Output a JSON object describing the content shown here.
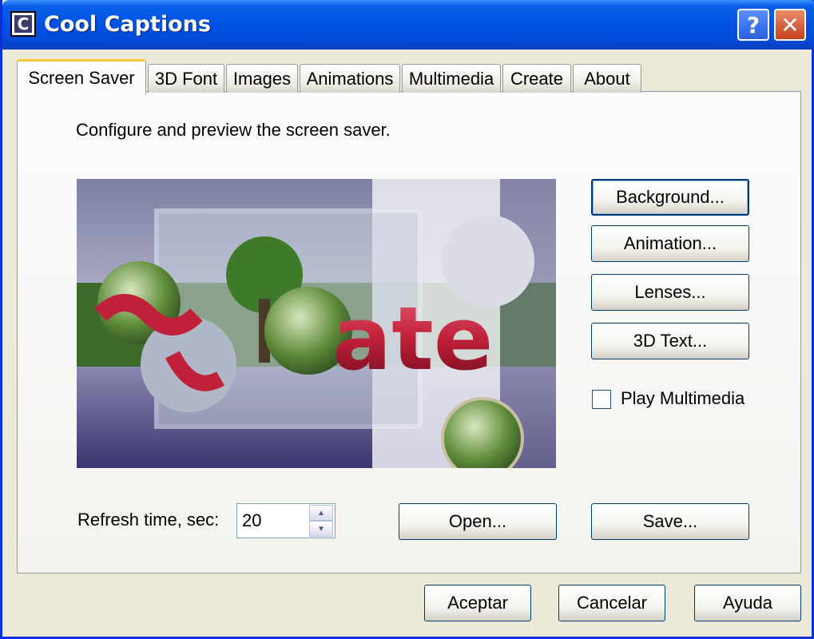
{
  "window": {
    "title": "Cool Captions",
    "icon_letter": "C",
    "help_glyph": "?",
    "close_glyph": "✕"
  },
  "tabs": [
    {
      "label": "Screen Saver",
      "active": true
    },
    {
      "label": "3D Font"
    },
    {
      "label": "Images"
    },
    {
      "label": "Animations"
    },
    {
      "label": "Multimedia"
    },
    {
      "label": "Create"
    },
    {
      "label": "About"
    }
  ],
  "panel": {
    "description": "Configure and preview the screen saver.",
    "preview_caption": "ate",
    "buttons": {
      "background": "Background...",
      "animation": "Animation...",
      "lenses": "Lenses...",
      "text3d": "3D Text...",
      "open": "Open...",
      "save": "Save..."
    },
    "play_multimedia": {
      "label": "Play Multimedia",
      "checked": false
    },
    "refresh": {
      "label": "Refresh time, sec:",
      "value": "20"
    }
  },
  "footer": {
    "ok": "Aceptar",
    "cancel": "Cancelar",
    "help": "Ayuda"
  },
  "colors": {
    "titlebar": "#0054e3",
    "face": "#ece9d8",
    "tab_highlight": "#ffc83c",
    "caption_red": "#c0203a"
  },
  "icons": [
    "app-icon",
    "help-icon",
    "close-icon",
    "spin-up-icon",
    "spin-down-icon"
  ]
}
